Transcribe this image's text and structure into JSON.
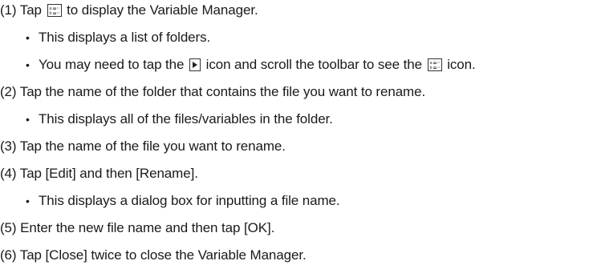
{
  "steps": [
    {
      "pre": "(1) Tap ",
      "icon": "variable-manager-icon",
      "post": " to display the Variable Manager."
    },
    {
      "bullet": "•",
      "text": "This displays a list of folders."
    },
    {
      "bullet": "•",
      "pre": "You may need to tap the ",
      "icon": "right-arrow-icon",
      "mid": " icon and scroll the toolbar to see the ",
      "icon2": "variable-manager-icon",
      "post": " icon."
    },
    {
      "text": "(2) Tap the name of the folder that contains the file you want to rename."
    },
    {
      "bullet": "•",
      "text": "This displays all of the files/variables in the folder."
    },
    {
      "text": "(3) Tap the name of the file you want to rename."
    },
    {
      "text": "(4) Tap [Edit] and then [Rename]."
    },
    {
      "bullet": "•",
      "text": "This displays a dialog box for inputting a file name."
    },
    {
      "text": "(5) Enter the new file name and then tap [OK]."
    },
    {
      "text": "(6) Tap [Close] twice to close the Variable Manager."
    }
  ]
}
